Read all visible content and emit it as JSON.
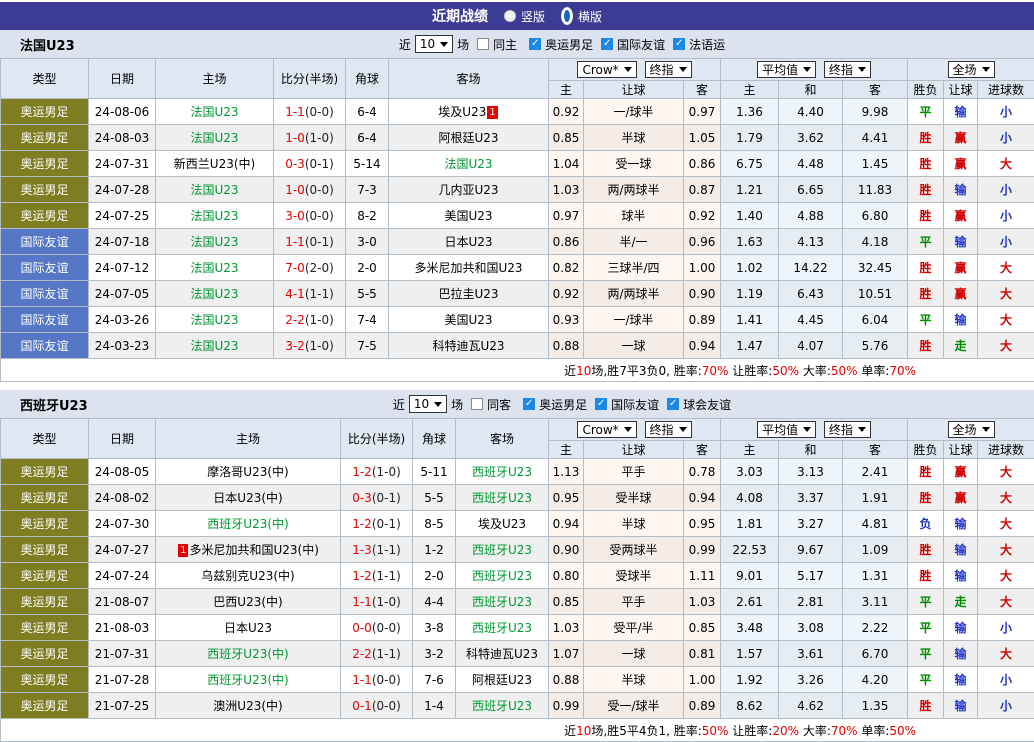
{
  "titlebar": {
    "title": "近期战绩",
    "options": [
      {
        "label": "竖版",
        "selected": false
      },
      {
        "label": "横版",
        "selected": true
      }
    ]
  },
  "columns": {
    "left": [
      "类型",
      "日期",
      "主场",
      "比分(半场)",
      "角球",
      "客场"
    ],
    "selects": {
      "book": "Crow*",
      "final": "终指",
      "avg": "平均值",
      "full": "全场"
    },
    "sub": [
      "主",
      "让球",
      "客",
      "主",
      "和",
      "客",
      "胜负",
      "让球",
      "进球数"
    ]
  },
  "colors": {
    "titlebar_purple": "#3d3c94",
    "olympic_badge": "#7e7d22",
    "friendly_badge": "#5677c5",
    "team_green": "#009933",
    "score_red": "#e60000",
    "result_red": "#d10000",
    "result_green": "#008800",
    "result_blue": "#2233cc",
    "checkbox_blue": "#1e88e5"
  },
  "sections": [
    {
      "team": "法国U23",
      "filter": {
        "prefix": "近",
        "count": "10",
        "suffix": "场",
        "same_label": "同主",
        "cats": [
          "奥运男足",
          "国际友谊",
          "法语运"
        ]
      },
      "rows": [
        {
          "type": "奥运男足",
          "type_style": "oly",
          "date": "24-08-06",
          "home": {
            "text": "法国U23",
            "green": true
          },
          "score": "1-1",
          "half": "(0-0)",
          "corner": "6-4",
          "away": {
            "text": "埃及U23",
            "badge": "1",
            "side": "right"
          },
          "o1": "0.92",
          "line": "一/球半",
          "o2": "0.97",
          "a1": "1.36",
          "a2": "4.40",
          "a3": "9.98",
          "r1": "平",
          "r2": "输",
          "r3": "小"
        },
        {
          "type": "奥运男足",
          "type_style": "oly",
          "date": "24-08-03",
          "home": {
            "text": "法国U23",
            "green": true
          },
          "score": "1-0",
          "half": "(1-0)",
          "corner": "6-4",
          "away": {
            "text": "阿根廷U23"
          },
          "o1": "0.85",
          "line": "半球",
          "o2": "1.05",
          "a1": "1.79",
          "a2": "3.62",
          "a3": "4.41",
          "r1": "胜",
          "r2": "赢",
          "r3": "小"
        },
        {
          "type": "奥运男足",
          "type_style": "oly",
          "date": "24-07-31",
          "home": {
            "text": "新西兰U23(中)"
          },
          "score": "0-3",
          "half": "(0-1)",
          "corner": "5-14",
          "away": {
            "text": "法国U23",
            "green": true
          },
          "o1": "1.04",
          "line": "受一球",
          "o2": "0.86",
          "a1": "6.75",
          "a2": "4.48",
          "a3": "1.45",
          "r1": "胜",
          "r2": "赢",
          "r3": "大"
        },
        {
          "type": "奥运男足",
          "type_style": "oly",
          "date": "24-07-28",
          "home": {
            "text": "法国U23",
            "green": true
          },
          "score": "1-0",
          "half": "(0-0)",
          "corner": "7-3",
          "away": {
            "text": "几内亚U23"
          },
          "o1": "1.03",
          "line": "两/两球半",
          "o2": "0.87",
          "a1": "1.21",
          "a2": "6.65",
          "a3": "11.83",
          "r1": "胜",
          "r2": "输",
          "r3": "小"
        },
        {
          "type": "奥运男足",
          "type_style": "oly",
          "date": "24-07-25",
          "home": {
            "text": "法国U23",
            "green": true
          },
          "score": "3-0",
          "half": "(0-0)",
          "corner": "8-2",
          "away": {
            "text": "美国U23"
          },
          "o1": "0.97",
          "line": "球半",
          "o2": "0.92",
          "a1": "1.40",
          "a2": "4.88",
          "a3": "6.80",
          "r1": "胜",
          "r2": "赢",
          "r3": "小"
        },
        {
          "type": "国际友谊",
          "type_style": "intl",
          "date": "24-07-18",
          "home": {
            "text": "法国U23",
            "green": true
          },
          "score": "1-1",
          "half": "(0-1)",
          "corner": "3-0",
          "away": {
            "text": "日本U23"
          },
          "o1": "0.86",
          "line": "半/一",
          "o2": "0.96",
          "a1": "1.63",
          "a2": "4.13",
          "a3": "4.18",
          "r1": "平",
          "r2": "输",
          "r3": "小"
        },
        {
          "type": "国际友谊",
          "type_style": "intl",
          "date": "24-07-12",
          "home": {
            "text": "法国U23",
            "green": true
          },
          "score": "7-0",
          "half": "(2-0)",
          "corner": "2-0",
          "away": {
            "text": "多米尼加共和国U23"
          },
          "o1": "0.82",
          "line": "三球半/四",
          "o2": "1.00",
          "a1": "1.02",
          "a2": "14.22",
          "a3": "32.45",
          "r1": "胜",
          "r2": "赢",
          "r3": "大"
        },
        {
          "type": "国际友谊",
          "type_style": "intl",
          "date": "24-07-05",
          "home": {
            "text": "法国U23",
            "green": true
          },
          "score": "4-1",
          "half": "(1-1)",
          "corner": "5-5",
          "away": {
            "text": "巴拉圭U23"
          },
          "o1": "0.92",
          "line": "两/两球半",
          "o2": "0.90",
          "a1": "1.19",
          "a2": "6.43",
          "a3": "10.51",
          "r1": "胜",
          "r2": "赢",
          "r3": "大"
        },
        {
          "type": "国际友谊",
          "type_style": "intl",
          "date": "24-03-26",
          "home": {
            "text": "法国U23",
            "green": true
          },
          "score": "2-2",
          "half": "(1-0)",
          "corner": "7-4",
          "away": {
            "text": "美国U23"
          },
          "o1": "0.93",
          "line": "一/球半",
          "o2": "0.89",
          "a1": "1.41",
          "a2": "4.45",
          "a3": "6.04",
          "r1": "平",
          "r2": "输",
          "r3": "大"
        },
        {
          "type": "国际友谊",
          "type_style": "intl",
          "date": "24-03-23",
          "home": {
            "text": "法国U23",
            "green": true
          },
          "score": "3-2",
          "half": "(1-0)",
          "corner": "7-5",
          "away": {
            "text": "科特迪瓦U23"
          },
          "o1": "0.88",
          "line": "一球",
          "o2": "0.94",
          "a1": "1.47",
          "a2": "4.07",
          "a3": "5.76",
          "r1": "胜",
          "r2": "走",
          "r3": "大"
        }
      ],
      "footer": [
        [
          "近",
          "k"
        ],
        [
          "10",
          "r"
        ],
        [
          "场,胜7平3负0, 胜率:",
          "k"
        ],
        [
          "70%",
          "r"
        ],
        [
          " 让胜率:",
          "k"
        ],
        [
          "50%",
          "r"
        ],
        [
          " 大率:",
          "k"
        ],
        [
          "50%",
          "r"
        ],
        [
          " 单率:",
          "k"
        ],
        [
          "70%",
          "r"
        ]
      ]
    },
    {
      "team": "西班牙U23",
      "filter": {
        "prefix": "近",
        "count": "10",
        "suffix": "场",
        "same_label": "同客",
        "cats": [
          "奥运男足",
          "国际友谊",
          "球会友谊"
        ]
      },
      "rows": [
        {
          "type": "奥运男足",
          "type_style": "oly",
          "date": "24-08-05",
          "home": {
            "text": "摩洛哥U23(中)"
          },
          "score": "1-2",
          "half": "(1-0)",
          "corner": "5-11",
          "away": {
            "text": "西班牙U23",
            "green": true
          },
          "o1": "1.13",
          "line": "平手",
          "o2": "0.78",
          "a1": "3.03",
          "a2": "3.13",
          "a3": "2.41",
          "r1": "胜",
          "r2": "赢",
          "r3": "大"
        },
        {
          "type": "奥运男足",
          "type_style": "oly",
          "date": "24-08-02",
          "home": {
            "text": "日本U23(中)"
          },
          "score": "0-3",
          "half": "(0-1)",
          "corner": "5-5",
          "away": {
            "text": "西班牙U23",
            "green": true
          },
          "o1": "0.95",
          "line": "受半球",
          "o2": "0.94",
          "a1": "4.08",
          "a2": "3.37",
          "a3": "1.91",
          "r1": "胜",
          "r2": "赢",
          "r3": "大"
        },
        {
          "type": "奥运男足",
          "type_style": "oly",
          "date": "24-07-30",
          "home": {
            "text": "西班牙U23(中)",
            "green": true
          },
          "score": "1-2",
          "half": "(0-1)",
          "corner": "8-5",
          "away": {
            "text": "埃及U23"
          },
          "o1": "0.94",
          "line": "半球",
          "o2": "0.95",
          "a1": "1.81",
          "a2": "3.27",
          "a3": "4.81",
          "r1": "负",
          "r2": "输",
          "r3": "大"
        },
        {
          "type": "奥运男足",
          "type_style": "oly",
          "date": "24-07-27",
          "home": {
            "text": "多米尼加共和国U23(中)",
            "badge": "1",
            "side": "left"
          },
          "score": "1-3",
          "half": "(1-1)",
          "corner": "1-2",
          "away": {
            "text": "西班牙U23",
            "green": true
          },
          "o1": "0.90",
          "line": "受两球半",
          "o2": "0.99",
          "a1": "22.53",
          "a2": "9.67",
          "a3": "1.09",
          "r1": "胜",
          "r2": "输",
          "r3": "大"
        },
        {
          "type": "奥运男足",
          "type_style": "oly",
          "date": "24-07-24",
          "home": {
            "text": "乌兹别克U23(中)"
          },
          "score": "1-2",
          "half": "(1-1)",
          "corner": "2-0",
          "away": {
            "text": "西班牙U23",
            "green": true
          },
          "o1": "0.80",
          "line": "受球半",
          "o2": "1.11",
          "a1": "9.01",
          "a2": "5.17",
          "a3": "1.31",
          "r1": "胜",
          "r2": "输",
          "r3": "大"
        },
        {
          "type": "奥运男足",
          "type_style": "oly",
          "date": "21-08-07",
          "home": {
            "text": "巴西U23(中)"
          },
          "score": "1-1",
          "half": "(1-0)",
          "corner": "4-4",
          "away": {
            "text": "西班牙U23",
            "green": true
          },
          "o1": "0.85",
          "line": "平手",
          "o2": "1.03",
          "a1": "2.61",
          "a2": "2.81",
          "a3": "3.11",
          "r1": "平",
          "r2": "走",
          "r3": "大"
        },
        {
          "type": "奥运男足",
          "type_style": "oly",
          "date": "21-08-03",
          "home": {
            "text": "日本U23"
          },
          "score": "0-0",
          "half": "(0-0)",
          "corner": "3-8",
          "away": {
            "text": "西班牙U23",
            "green": true
          },
          "o1": "1.03",
          "line": "受平/半",
          "o2": "0.85",
          "a1": "3.48",
          "a2": "3.08",
          "a3": "2.22",
          "r1": "平",
          "r2": "输",
          "r3": "小"
        },
        {
          "type": "奥运男足",
          "type_style": "oly",
          "date": "21-07-31",
          "home": {
            "text": "西班牙U23(中)",
            "green": true
          },
          "score": "2-2",
          "half": "(1-1)",
          "corner": "3-2",
          "away": {
            "text": "科特迪瓦U23"
          },
          "o1": "1.07",
          "line": "一球",
          "o2": "0.81",
          "a1": "1.57",
          "a2": "3.61",
          "a3": "6.70",
          "r1": "平",
          "r2": "输",
          "r3": "大"
        },
        {
          "type": "奥运男足",
          "type_style": "oly",
          "date": "21-07-28",
          "home": {
            "text": "西班牙U23(中)",
            "green": true
          },
          "score": "1-1",
          "half": "(0-0)",
          "corner": "7-6",
          "away": {
            "text": "阿根廷U23"
          },
          "o1": "0.88",
          "line": "半球",
          "o2": "1.00",
          "a1": "1.92",
          "a2": "3.26",
          "a3": "4.20",
          "r1": "平",
          "r2": "输",
          "r3": "小"
        },
        {
          "type": "奥运男足",
          "type_style": "oly",
          "date": "21-07-25",
          "home": {
            "text": "澳洲U23(中)"
          },
          "score": "0-1",
          "half": "(0-0)",
          "corner": "1-4",
          "away": {
            "text": "西班牙U23",
            "green": true
          },
          "o1": "0.99",
          "line": "受一/球半",
          "o2": "0.89",
          "a1": "8.62",
          "a2": "4.62",
          "a3": "1.35",
          "r1": "胜",
          "r2": "输",
          "r3": "小"
        }
      ],
      "footer": [
        [
          "近",
          "k"
        ],
        [
          "10",
          "r"
        ],
        [
          "场,胜5平4负1, 胜率:",
          "k"
        ],
        [
          "50%",
          "r"
        ],
        [
          " 让胜率:",
          "k"
        ],
        [
          "20%",
          "r"
        ],
        [
          " 大率:",
          "k"
        ],
        [
          "70%",
          "r"
        ],
        [
          " 单率:",
          "k"
        ],
        [
          "50%",
          "r"
        ]
      ]
    }
  ]
}
